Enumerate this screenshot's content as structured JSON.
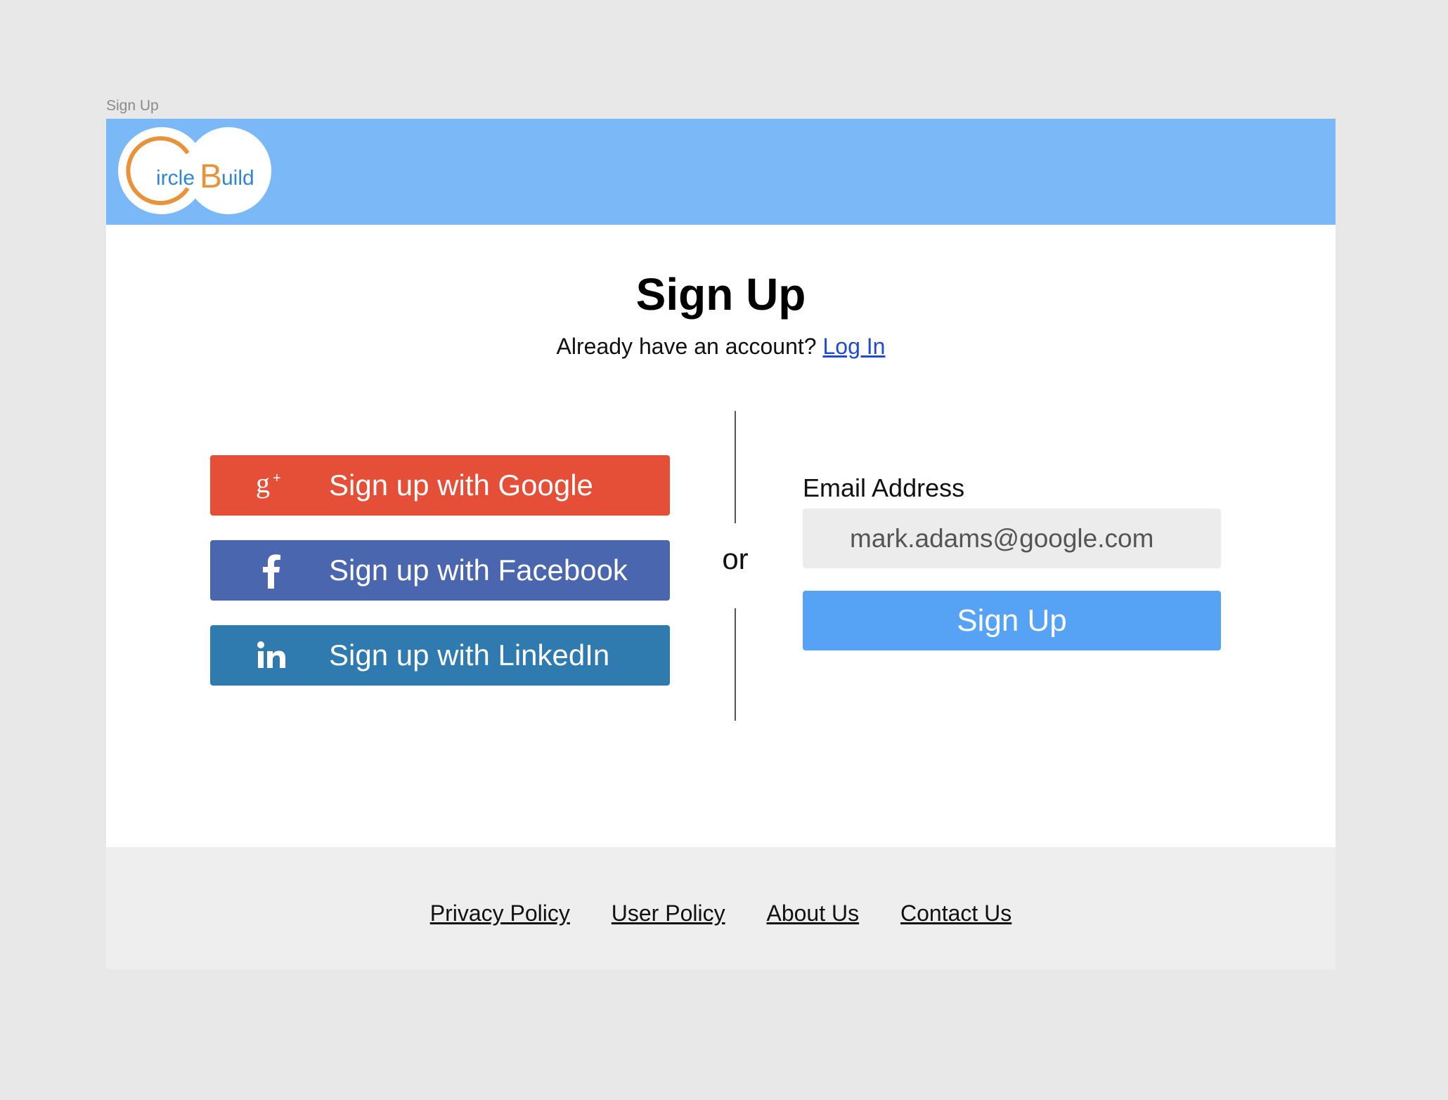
{
  "frame": {
    "label": "Sign Up"
  },
  "brand": {
    "logo_letter_c": "C",
    "logo_text_1": "ircle",
    "logo_letter_b": "B",
    "logo_text_2": "uild",
    "header_color": "#7bb8f8",
    "logo_orange": "#e8923a",
    "logo_blue": "#2f86d8"
  },
  "page": {
    "title": "Sign Up",
    "subtitle": "Already have an account?",
    "login_link": "Log In"
  },
  "social": [
    {
      "label": "Sign up with Google",
      "icon": "google-plus-icon",
      "color": "#e54f37"
    },
    {
      "label": "Sign up with Facebook",
      "icon": "facebook-icon",
      "color": "#4a66ae"
    },
    {
      "label": "Sign up with LinkedIn",
      "icon": "linkedin-icon",
      "color": "#2f7aaf"
    }
  ],
  "divider_text": "or",
  "form": {
    "email_label": "Email Address",
    "email_placeholder": "mark.adams@google.com",
    "submit_label": "Sign Up",
    "submit_color": "#56a3f6"
  },
  "footer": {
    "links": [
      "Privacy Policy",
      "User Policy",
      "About Us",
      "Contact Us"
    ]
  }
}
